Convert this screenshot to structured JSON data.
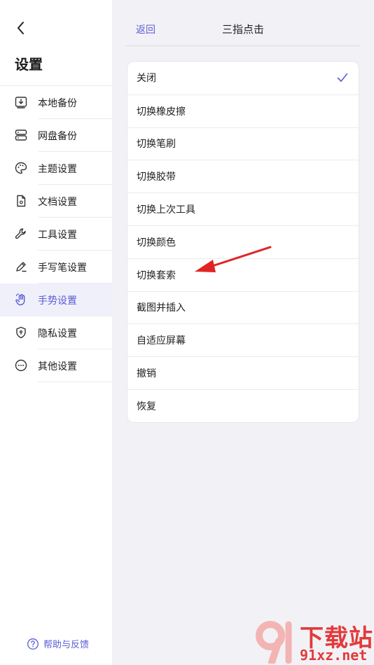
{
  "sidebar": {
    "title": "设置",
    "items": [
      {
        "label": "本地备份",
        "icon": "local-backup-icon"
      },
      {
        "label": "网盘备份",
        "icon": "cloud-backup-icon"
      },
      {
        "label": "主题设置",
        "icon": "palette-icon"
      },
      {
        "label": "文档设置",
        "icon": "document-icon"
      },
      {
        "label": "工具设置",
        "icon": "wrench-icon"
      },
      {
        "label": "手写笔设置",
        "icon": "pen-icon"
      },
      {
        "label": "手势设置",
        "icon": "hand-gesture-icon",
        "active": true
      },
      {
        "label": "隐私设置",
        "icon": "shield-icon"
      },
      {
        "label": "其他设置",
        "icon": "more-icon"
      }
    ],
    "help_label": "帮助与反馈"
  },
  "header": {
    "back_label": "返回",
    "title": "三指点击"
  },
  "options": [
    {
      "label": "关闭",
      "selected": true
    },
    {
      "label": "切换橡皮擦"
    },
    {
      "label": "切换笔刷"
    },
    {
      "label": "切换胶带"
    },
    {
      "label": "切换上次工具"
    },
    {
      "label": "切换颜色"
    },
    {
      "label": "切换套索"
    },
    {
      "label": "截图并插入"
    },
    {
      "label": "自适应屏幕"
    },
    {
      "label": "撤销"
    },
    {
      "label": "恢复"
    }
  ],
  "watermark": {
    "text": "下载站",
    "url": "91xz.net"
  },
  "colors": {
    "accent": "#5b5bd6",
    "active_bg": "#f0f0fb",
    "annotation": "#e02424"
  }
}
